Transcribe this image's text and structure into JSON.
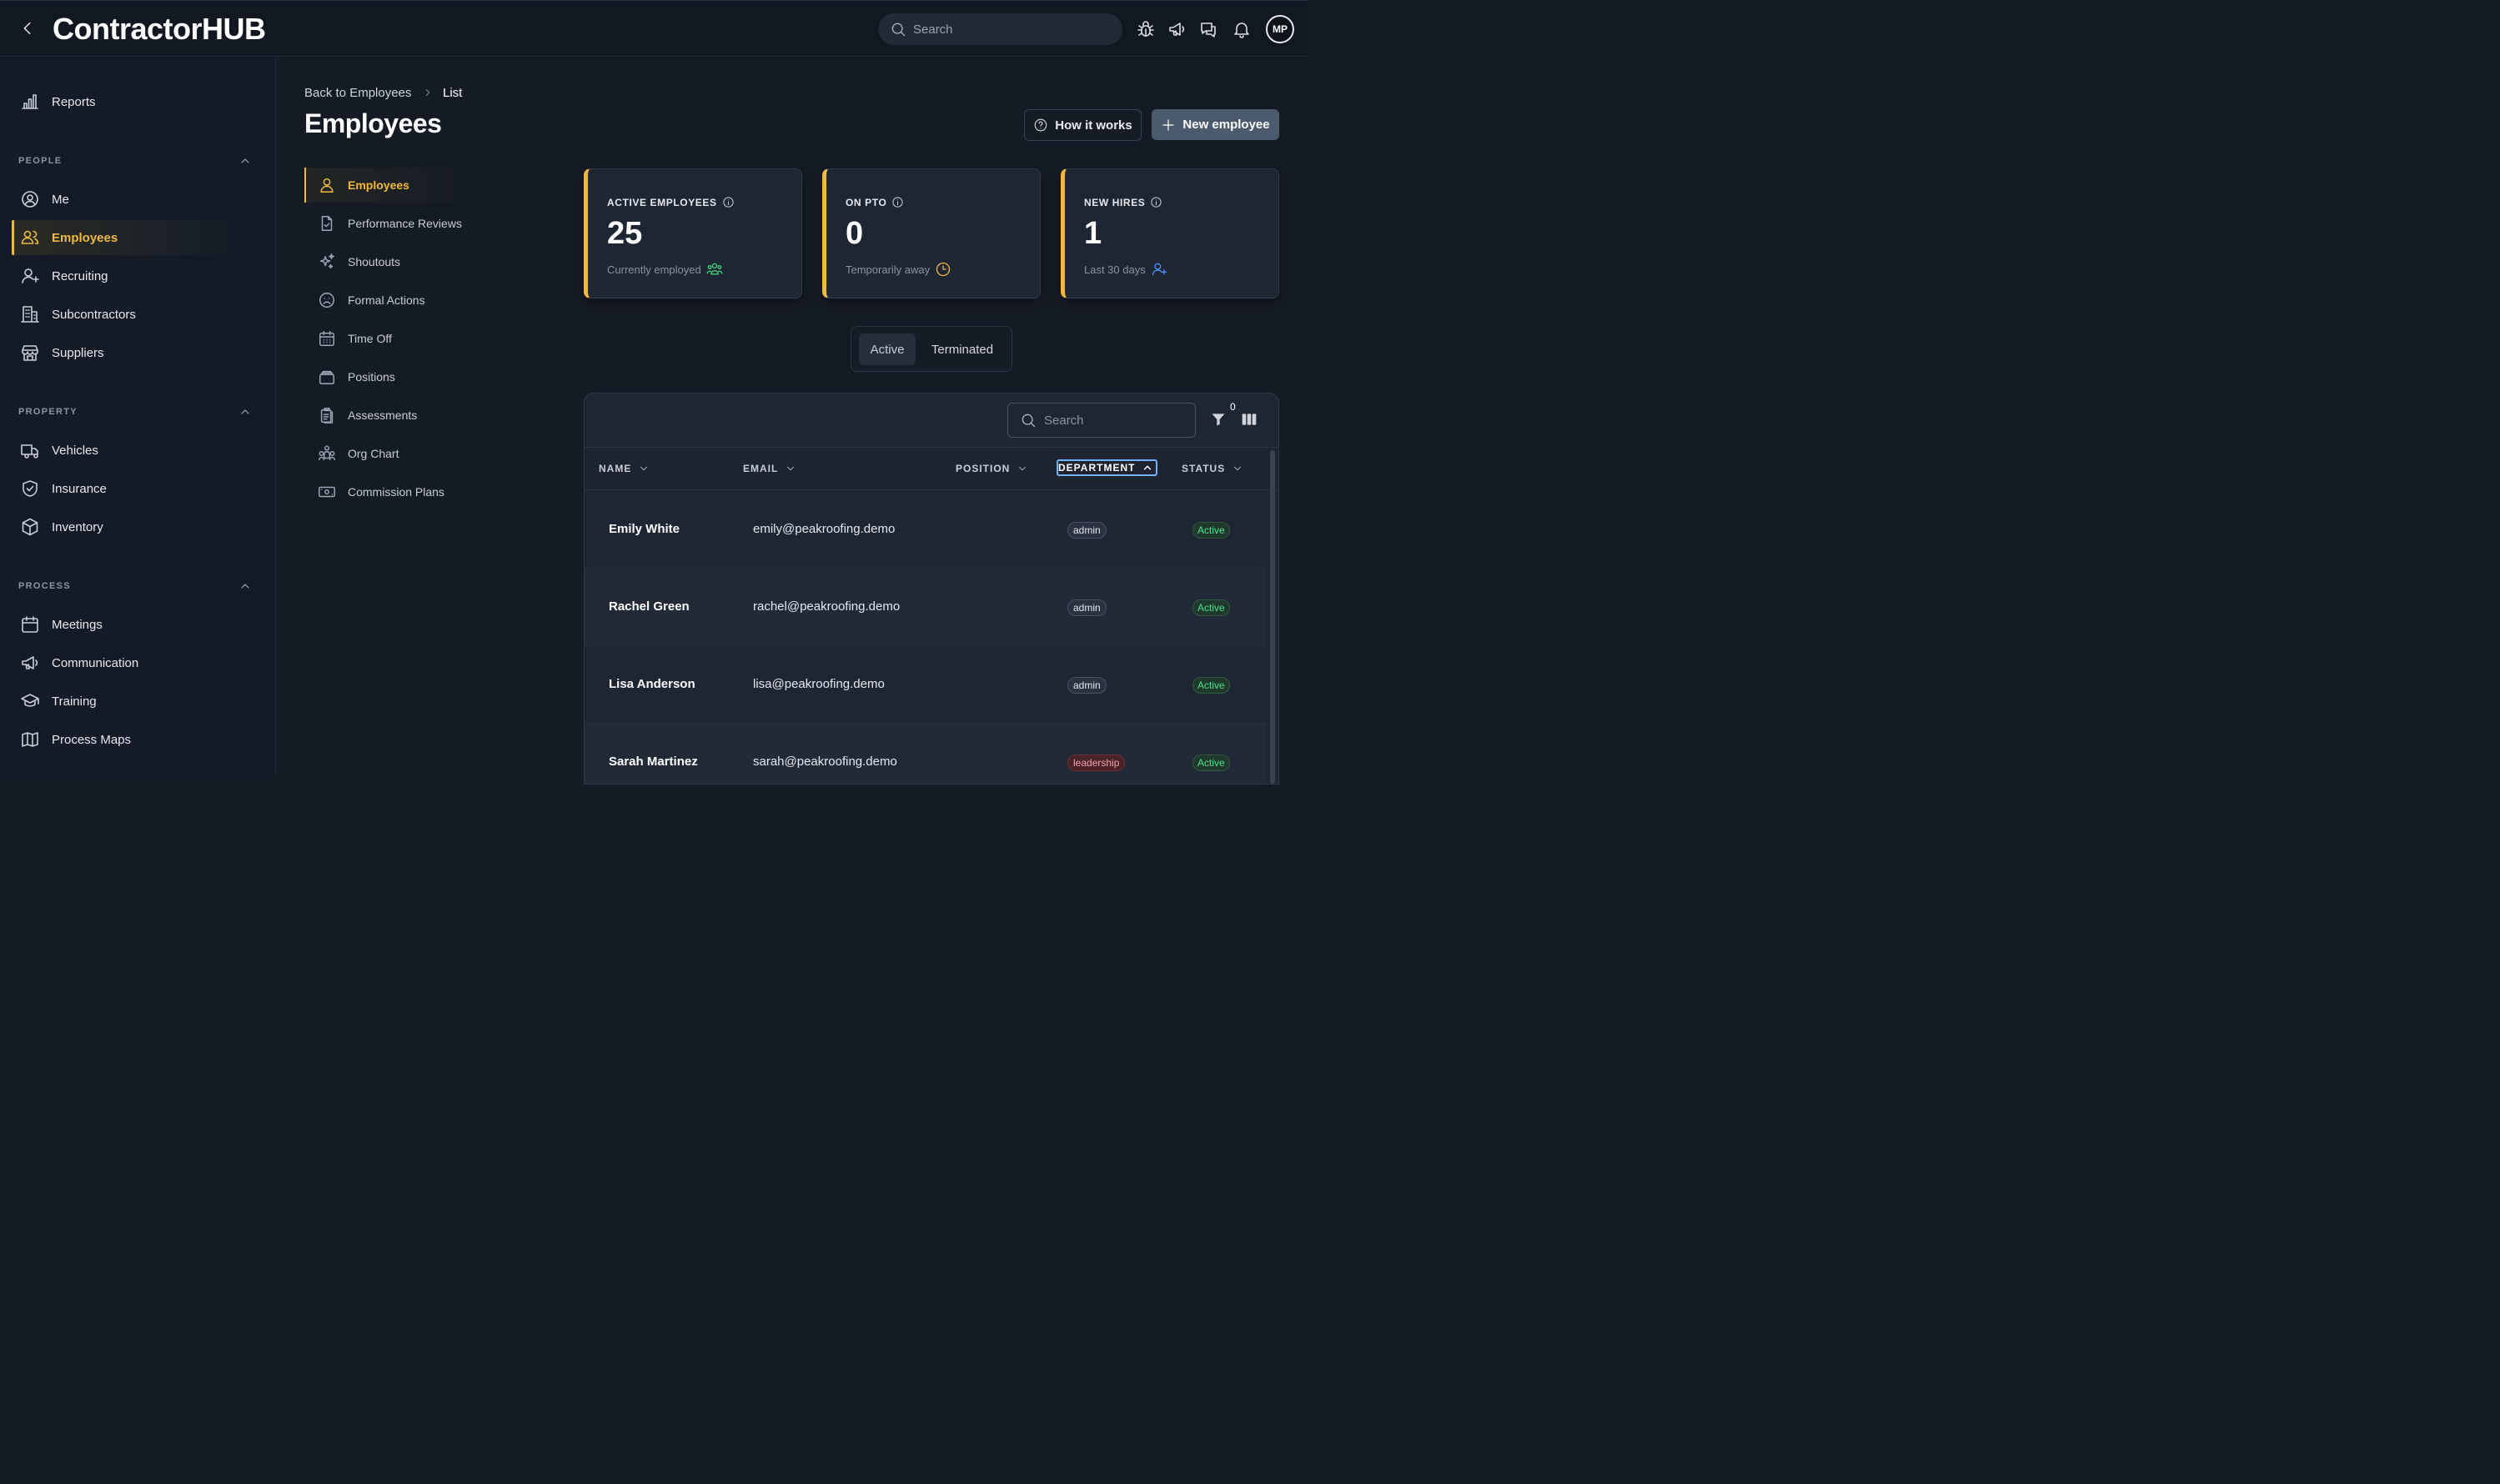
{
  "app": {
    "logo": "ContractorHUB"
  },
  "topbar": {
    "search_placeholder": "Search",
    "avatar_initials": "MP"
  },
  "sidebar": {
    "reports": "Reports",
    "sections": [
      {
        "label": "PEOPLE",
        "items": [
          "Me",
          "Employees",
          "Recruiting",
          "Subcontractors",
          "Suppliers"
        ]
      },
      {
        "label": "PROPERTY",
        "items": [
          "Vehicles",
          "Insurance",
          "Inventory"
        ]
      },
      {
        "label": "PROCESS",
        "items": [
          "Meetings",
          "Communication",
          "Training",
          "Process Maps"
        ]
      }
    ],
    "active_item": "Employees"
  },
  "breadcrumb": {
    "back": "Back to Employees",
    "current": "List"
  },
  "page_title": "Employees",
  "actions": {
    "how": "How it works",
    "new": "New employee"
  },
  "submenu": [
    "Employees",
    "Performance Reviews",
    "Shoutouts",
    "Formal Actions",
    "Time Off",
    "Positions",
    "Assessments",
    "Org Chart",
    "Commission Plans"
  ],
  "cards": [
    {
      "label": "ACTIVE EMPLOYEES",
      "value": "25",
      "sub": "Currently employed",
      "icon": "team-icon",
      "icon_color": "#3fd27a"
    },
    {
      "label": "ON PTO",
      "value": "0",
      "sub": "Temporarily away",
      "icon": "clock-icon",
      "icon_color": "#f0b840"
    },
    {
      "label": "NEW HIRES",
      "value": "1",
      "sub": "Last 30 days",
      "icon": "add-user-icon",
      "icon_color": "#4c8dff"
    }
  ],
  "toggle": {
    "active": "Active",
    "terminated": "Terminated"
  },
  "table": {
    "search_placeholder": "Search",
    "filter_count": "0",
    "columns": [
      "NAME",
      "EMAIL",
      "POSITION",
      "DEPARTMENT",
      "STATUS"
    ],
    "rows": [
      {
        "name": "Emily White",
        "email": "emily@peakroofing.demo",
        "department": "admin",
        "status": "Active"
      },
      {
        "name": "Rachel Green",
        "email": "rachel@peakroofing.demo",
        "department": "admin",
        "status": "Active"
      },
      {
        "name": "Lisa Anderson",
        "email": "lisa@peakroofing.demo",
        "department": "admin",
        "status": "Active"
      },
      {
        "name": "Sarah Martinez",
        "email": "sarah@peakroofing.demo",
        "department": "leadership",
        "status": "Active"
      }
    ]
  },
  "colors": {
    "accent": "#f0b840",
    "active_status": "#4ee08a",
    "background": "#151b25"
  }
}
